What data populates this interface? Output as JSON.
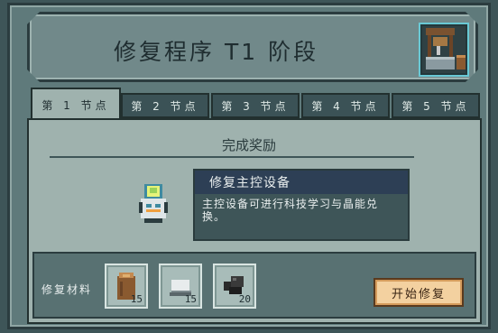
{
  "header": {
    "title": "修复程序 T1 阶段",
    "icon": "well-icon"
  },
  "tabs": [
    {
      "label": "第 1 节点",
      "active": true
    },
    {
      "label": "第 2 节点",
      "active": false
    },
    {
      "label": "第 3 节点",
      "active": false
    },
    {
      "label": "第 4 节点",
      "active": false
    },
    {
      "label": "第 5 节点",
      "active": false
    }
  ],
  "reward": {
    "section_title": "完成奖励",
    "item_title": "修复主控设备",
    "item_desc": "主控设备可进行科技学习与晶能兑换。",
    "icon": "robot-console-icon"
  },
  "materials": {
    "label": "修复材料",
    "items": [
      {
        "icon": "wood-log-icon",
        "count": "15"
      },
      {
        "icon": "metal-ingot-icon",
        "count": "15"
      },
      {
        "icon": "coal-icon",
        "count": "20"
      }
    ]
  },
  "actions": {
    "start_label": "开始修复"
  }
}
